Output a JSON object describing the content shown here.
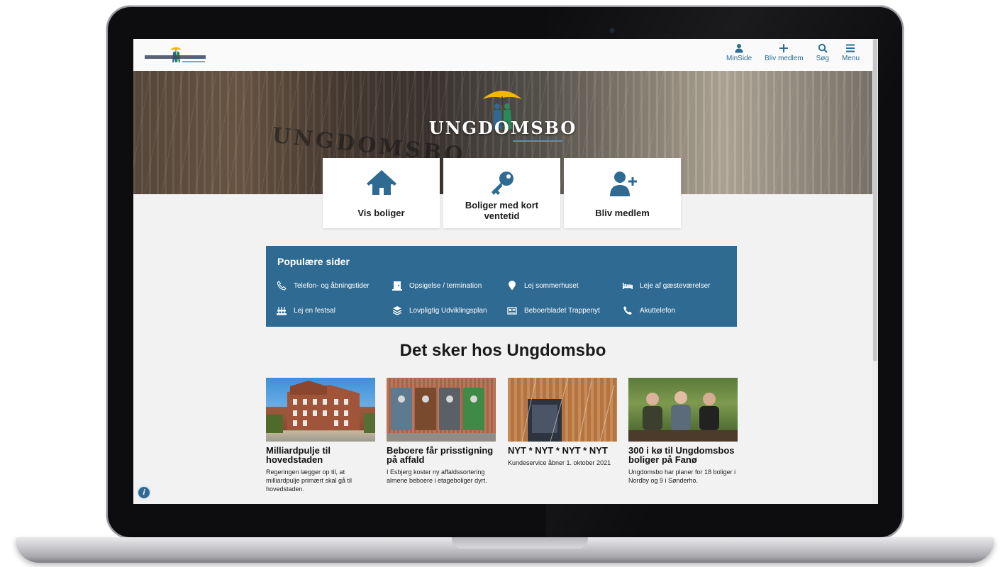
{
  "header": {
    "nav": [
      {
        "icon": "user-icon",
        "label": "MinSide"
      },
      {
        "icon": "plus-icon",
        "label": "Bliv medlem"
      },
      {
        "icon": "search-icon",
        "label": "Søg"
      },
      {
        "icon": "menu-icon",
        "label": "Menu"
      }
    ]
  },
  "hero": {
    "title": "UNGDOMSBO",
    "background_text": "UNGDOMSBO"
  },
  "cards": [
    {
      "icon": "house-icon",
      "label": "Vis boliger"
    },
    {
      "icon": "key-icon",
      "label": "Boliger med kort ventetid"
    },
    {
      "icon": "user-plus-icon",
      "label": "Bliv medlem"
    }
  ],
  "popular": {
    "title": "Populære sider",
    "links": [
      {
        "icon": "phone-outline-icon",
        "label": "Telefon- og åbningstider"
      },
      {
        "icon": "door-exit-icon",
        "label": "Opsigelse / termination"
      },
      {
        "icon": "map-pin-icon",
        "label": "Lej sommerhuset"
      },
      {
        "icon": "bed-icon",
        "label": "Leje af gæsteværelser"
      },
      {
        "icon": "party-hall-icon",
        "label": "Lej en festsal"
      },
      {
        "icon": "layers-icon",
        "label": "Lovpligtig Udviklingsplan"
      },
      {
        "icon": "newspaper-icon",
        "label": "Beboerbladet Trappenyt"
      },
      {
        "icon": "phone-icon",
        "label": "Akuttelefon"
      }
    ]
  },
  "news": {
    "heading": "Det sker hos Ungdomsbo",
    "items": [
      {
        "title": "Milliardpulje til hovedstaden",
        "text": "Regeringen lægger op til, at milliardpulje primært skal gå til hovedstaden."
      },
      {
        "title": "Beboere får prisstigning på affald",
        "text": "I Esbjerg koster ny affaldssortering almene beboere i etageboliger dyrt."
      },
      {
        "title": "NYT * NYT * NYT * NYT",
        "text": "Kundeservice åbner 1. oktober 2021"
      },
      {
        "title": "300 i kø til Ungdomsbos boliger på Fanø",
        "text": "Ungdomsbo har planer for 18 boliger i Nordby og 9 i Sønderho."
      }
    ]
  },
  "colors": {
    "accent": "#2f6a92",
    "nav_text": "#2c6e96",
    "umbrella": "#f2b705"
  }
}
